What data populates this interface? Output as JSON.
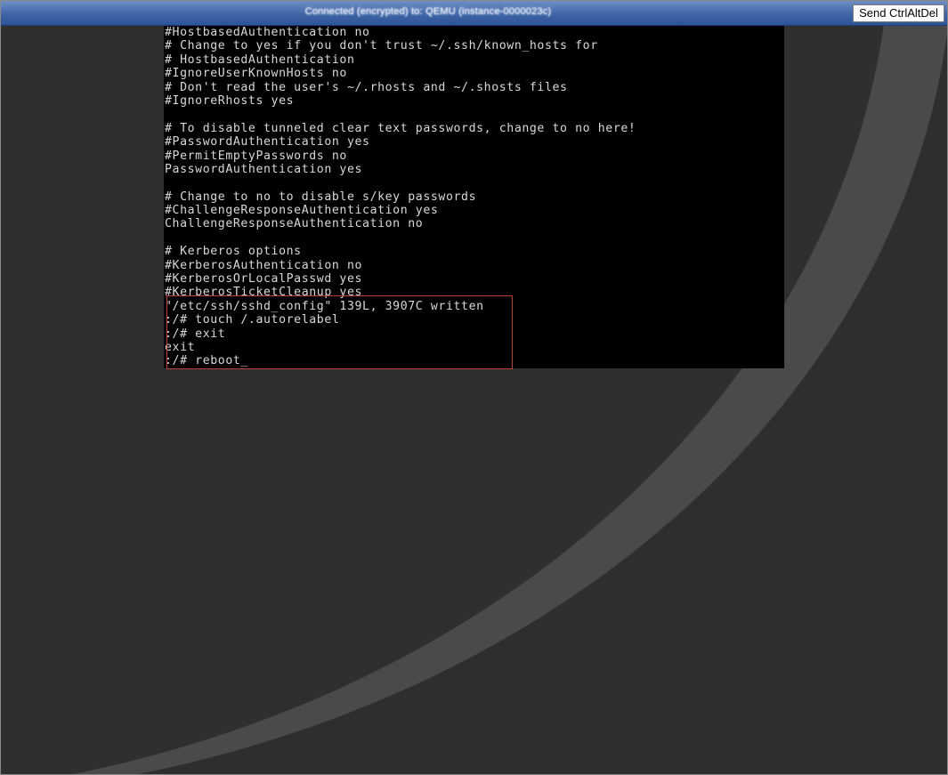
{
  "window": {
    "title": "Connected (encrypted) to: QEMU (instance-0000023c)",
    "send_ctrl_alt_del_label": "Send CtrlAltDel"
  },
  "console": {
    "lines": [
      "#HostbasedAuthentication no",
      "# Change to yes if you don't trust ~/.ssh/known_hosts for",
      "# HostbasedAuthentication",
      "#IgnoreUserKnownHosts no",
      "# Don't read the user's ~/.rhosts and ~/.shosts files",
      "#IgnoreRhosts yes",
      "",
      "# To disable tunneled clear text passwords, change to no here!",
      "#PasswordAuthentication yes",
      "#PermitEmptyPasswords no",
      "PasswordAuthentication yes",
      "",
      "# Change to no to disable s/key passwords",
      "#ChallengeResponseAuthentication yes",
      "ChallengeResponseAuthentication no",
      "",
      "# Kerberos options",
      "#KerberosAuthentication no",
      "#KerberosOrLocalPasswd yes",
      "#KerberosTicketCleanup yes",
      "\"/etc/ssh/sshd_config\" 139L, 3907C written",
      ":/# touch /.autorelabel",
      ":/# exit",
      "exit",
      ":/# reboot_"
    ]
  },
  "colors": {
    "console_bg": "#000000",
    "console_fg": "#d8d8d8",
    "titlebar": "#3f65a7",
    "highlight_border": "#b8423a"
  }
}
